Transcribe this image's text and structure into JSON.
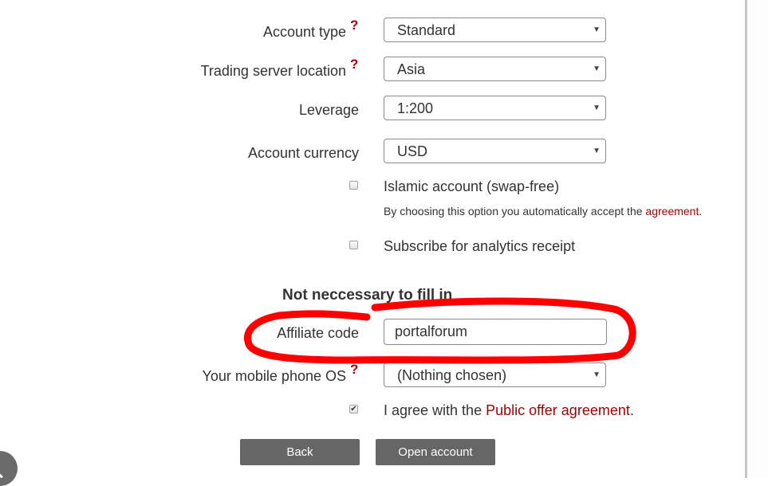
{
  "form": {
    "fields": [
      {
        "label": "Account type",
        "help": "?",
        "value": "Standard"
      },
      {
        "label": "Trading server location",
        "help": "?",
        "value": "Asia"
      },
      {
        "label": "Leverage",
        "value": "1:200"
      },
      {
        "label": "Account currency",
        "value": "USD"
      }
    ],
    "islamic": {
      "label": "Islamic account (swap-free)",
      "checked": false,
      "note_prefix": "By choosing this option you automatically accept the ",
      "note_link": "agreement",
      "note_suffix": "."
    },
    "analytics": {
      "label": "Subscribe for analytics receipt",
      "checked": false
    },
    "optional_section": {
      "title": "Not neccessary to fill in",
      "affiliate": {
        "label": "Affiliate code",
        "value": "portalforum"
      },
      "mobile_os": {
        "label": "Your mobile phone OS",
        "help": "?",
        "value": "(Nothing chosen)"
      }
    },
    "agree": {
      "checked": true,
      "prefix": "I agree with the ",
      "link": "Public offer agreement",
      "suffix": "."
    },
    "dropdown_arrow": "▼",
    "checkmark": "✔"
  },
  "buttons": {
    "back": "Back",
    "open_account": "Open account"
  },
  "annotation": {
    "color": "#ff0000",
    "shape": "hand-drawn ellipse around Affiliate code"
  },
  "colors": {
    "link": "#a30000",
    "button_bg": "#666666",
    "help_mark": "#a30000"
  }
}
